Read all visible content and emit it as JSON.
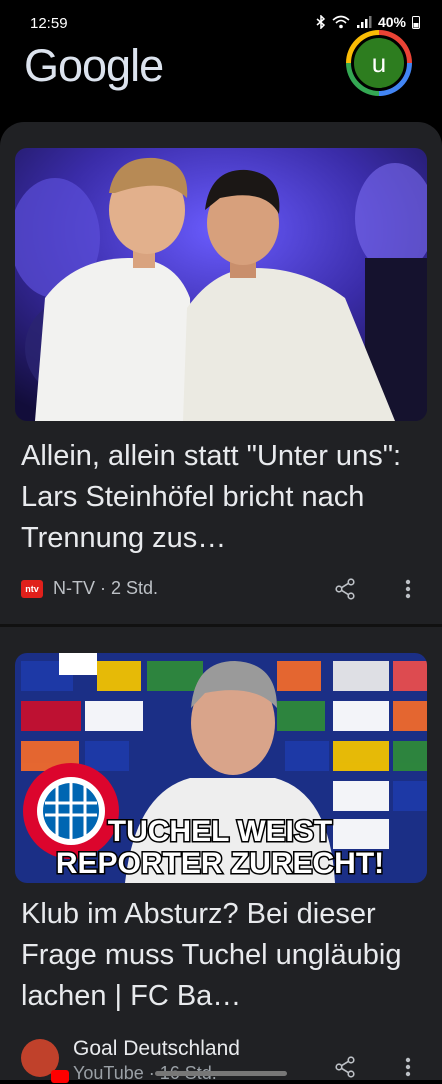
{
  "status_bar": {
    "time": "12:59",
    "battery": "40%"
  },
  "header": {
    "logo_text": "Google",
    "avatar_letter": "u"
  },
  "cards": [
    {
      "title": "Allein, allein statt \"Unter uns\": Lars Steinhöfel bricht nach Trennung zus…",
      "source_logo": "ntv",
      "source": "N-TV · 2 Std."
    },
    {
      "title": "Klub im Absturz? Bei dieser Frage muss Tuchel ungläubig lachen | FC Ba…",
      "overlay_line1": "TUCHEL WEIST",
      "overlay_line2": "REPORTER ZURECHT!",
      "source": "Goal Deutschland",
      "source_sub": "YouTube · 16 Std."
    }
  ],
  "icons": {
    "share": "share-icon",
    "more": "more-vert-icon",
    "bluetooth": "bluetooth-icon",
    "wifi": "wifi-icon",
    "signal": "signal-icon",
    "battery": "battery-icon"
  },
  "colors": {
    "background": "#000000",
    "card": "#202124",
    "text": "#e8eaed",
    "avatar": "#2d7d1f"
  }
}
